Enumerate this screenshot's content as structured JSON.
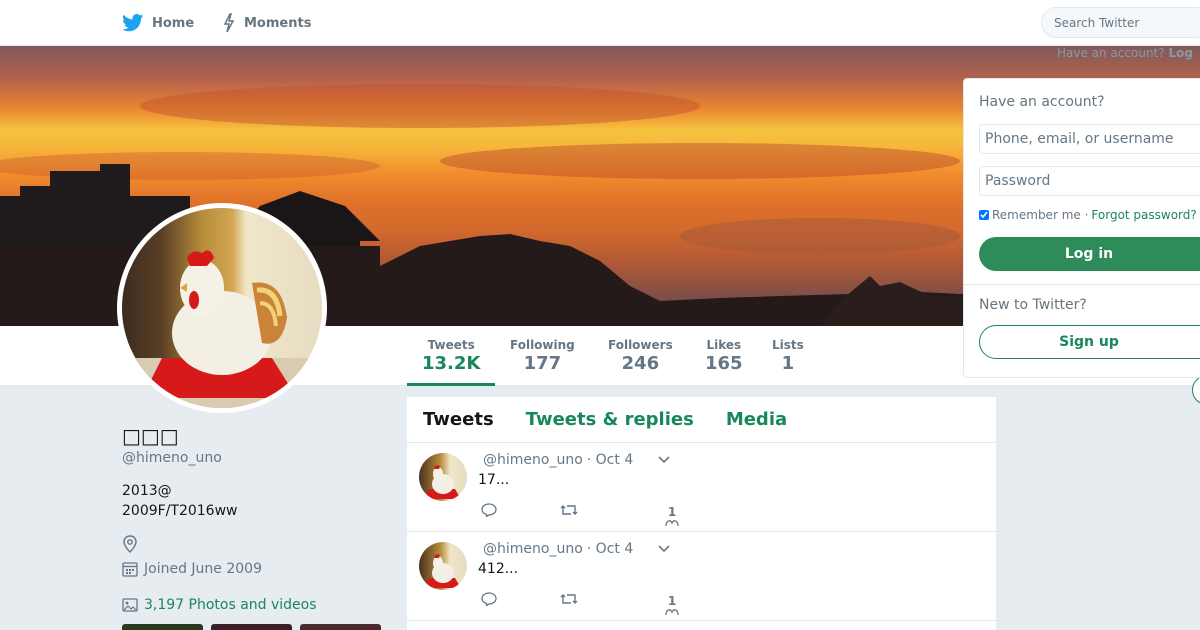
{
  "nav": {
    "home_label": "Home",
    "moments_label": "Moments",
    "search_placeholder": "Search Twitter",
    "have_account_text": "Have an account?",
    "login_link": "Log"
  },
  "profile": {
    "name": "□□□",
    "handle": "@himeno_uno",
    "bio": "2013@\n2009F/T2016ww",
    "location": "",
    "joined": "Joined June 2009",
    "photos_videos": "3,197 Photos and videos"
  },
  "stats": [
    {
      "label": "Tweets",
      "value": "13.2K"
    },
    {
      "label": "Following",
      "value": "177"
    },
    {
      "label": "Followers",
      "value": "246"
    },
    {
      "label": "Likes",
      "value": "165"
    },
    {
      "label": "Lists",
      "value": "1"
    }
  ],
  "timeline": {
    "tabs": [
      "Tweets",
      "Tweets & replies",
      "Media"
    ],
    "tweets": [
      {
        "handle": "@himeno_uno",
        "date": "· Oct 4",
        "text": "17...",
        "likes": "1"
      },
      {
        "handle": "@himeno_uno",
        "date": "· Oct 4",
        "text": "412...",
        "likes": "1"
      }
    ]
  },
  "login": {
    "heading": "Have an account?",
    "username_placeholder": "Phone, email, or username",
    "password_placeholder": "Password",
    "remember_label": "Remember me ·",
    "forgot_label": "Forgot password?",
    "login_button": "Log in",
    "new_to_label": "New to Twitter?",
    "signup_button": "Sign up"
  },
  "colors": {
    "accent": "#19875a",
    "twitter_blue": "#1da1f2",
    "login_button": "#2e8b5a"
  }
}
